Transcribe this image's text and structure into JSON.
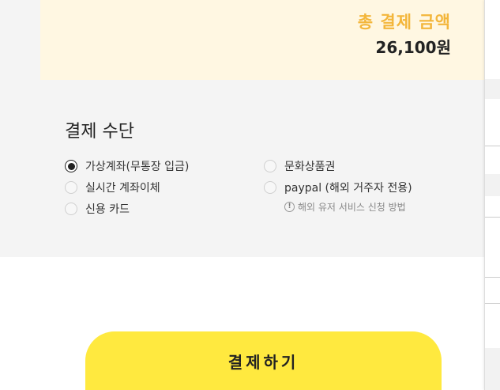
{
  "summary": {
    "total_label": "총 결제 금액",
    "total_value": "26,100원"
  },
  "payment": {
    "title": "결제 수단",
    "selected": "가상계좌(무통장 입금)",
    "options_left": [
      {
        "label": "가상계좌(무통장 입금)",
        "checked": true
      },
      {
        "label": "실시간 계좌이체",
        "checked": false
      },
      {
        "label": "신용 카드",
        "checked": false
      }
    ],
    "options_right": [
      {
        "label": "문화상품권",
        "checked": false
      },
      {
        "label": "paypal (해외 거주자 전용)",
        "checked": false
      }
    ],
    "overseas_notice": "해외 유저 서비스 신청 방법",
    "info_glyph": "!"
  },
  "actions": {
    "pay_button": "결제하기"
  },
  "colors": {
    "accent_yellow": "#ffe93f",
    "total_label": "#f3b63b",
    "summary_bg": "#fff7e2"
  }
}
